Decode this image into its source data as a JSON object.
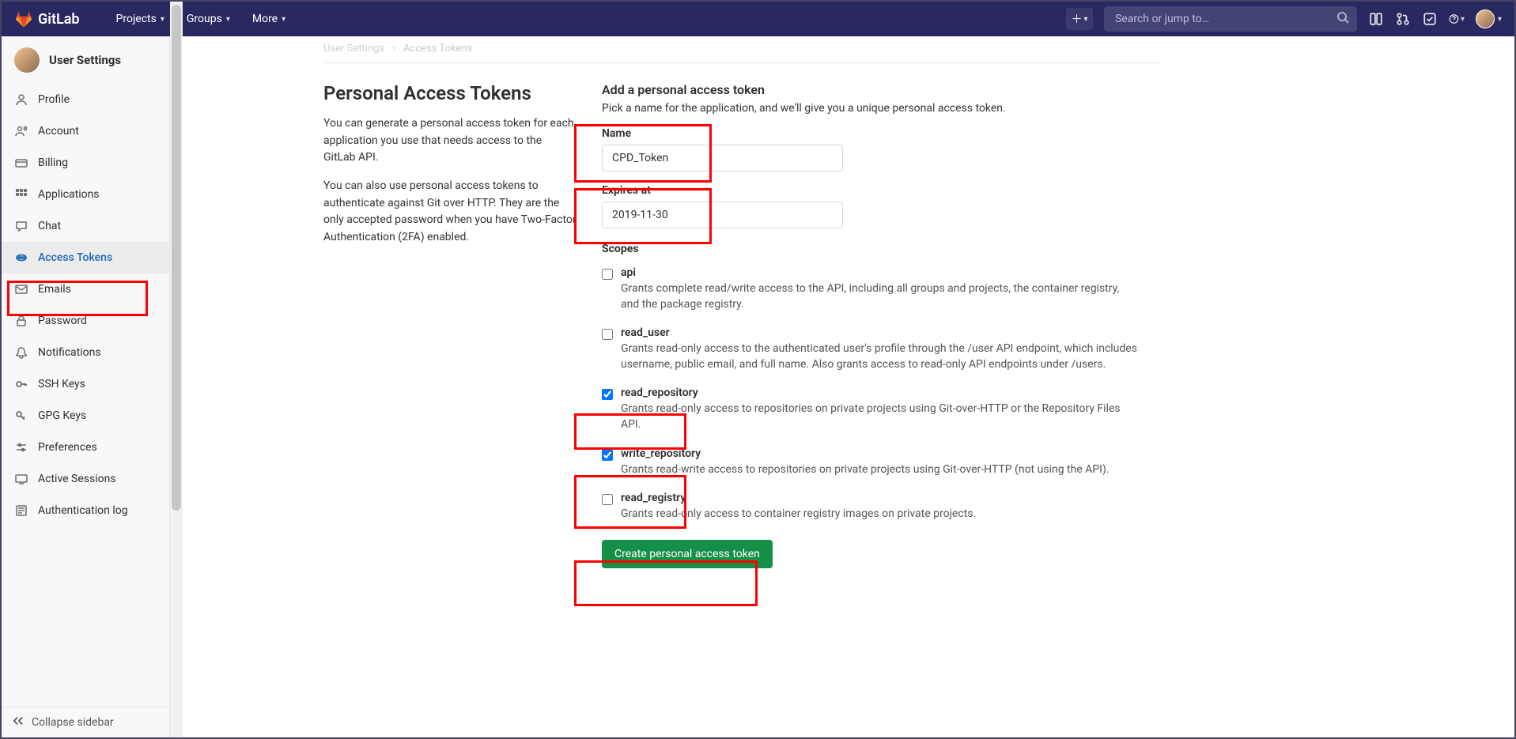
{
  "topbar": {
    "brand": "GitLab",
    "menu": [
      "Projects",
      "Groups",
      "More"
    ],
    "search_placeholder": "Search or jump to…"
  },
  "sidebar": {
    "title": "User Settings",
    "items": [
      {
        "icon": "profile",
        "label": "Profile"
      },
      {
        "icon": "account",
        "label": "Account"
      },
      {
        "icon": "billing",
        "label": "Billing"
      },
      {
        "icon": "apps",
        "label": "Applications"
      },
      {
        "icon": "chat",
        "label": "Chat"
      },
      {
        "icon": "tokens",
        "label": "Access Tokens"
      },
      {
        "icon": "emails",
        "label": "Emails"
      },
      {
        "icon": "password",
        "label": "Password"
      },
      {
        "icon": "notif",
        "label": "Notifications"
      },
      {
        "icon": "ssh",
        "label": "SSH Keys"
      },
      {
        "icon": "gpg",
        "label": "GPG Keys"
      },
      {
        "icon": "pref",
        "label": "Preferences"
      },
      {
        "icon": "sessions",
        "label": "Active Sessions"
      },
      {
        "icon": "auth",
        "label": "Authentication log"
      }
    ],
    "collapse": "Collapse sidebar"
  },
  "breadcrumb": {
    "a": "User Settings",
    "b": "Access Tokens"
  },
  "left": {
    "title": "Personal Access Tokens",
    "p1": "You can generate a personal access token for each application you use that needs access to the GitLab API.",
    "p2": "You can also use personal access tokens to authenticate against Git over HTTP. They are the only accepted password when you have Two-Factor Authentication (2FA) enabled."
  },
  "form": {
    "title": "Add a personal access token",
    "sub": "Pick a name for the application, and we'll give you a unique personal access token.",
    "name_label": "Name",
    "name_value": "CPD_Token",
    "expires_label": "Expires at",
    "expires_value": "2019-11-30",
    "scopes_label": "Scopes",
    "scopes": [
      {
        "key": "api",
        "label": "api",
        "checked": false,
        "desc": "Grants complete read/write access to the API, including all groups and projects, the container registry, and the package registry."
      },
      {
        "key": "read_user",
        "label": "read_user",
        "checked": false,
        "desc": "Grants read-only access to the authenticated user's profile through the /user API endpoint, which includes username, public email, and full name. Also grants access to read-only API endpoints under /users."
      },
      {
        "key": "read_repository",
        "label": "read_repository",
        "checked": true,
        "desc": "Grants read-only access to repositories on private projects using Git-over-HTTP or the Repository Files API."
      },
      {
        "key": "write_repository",
        "label": "write_repository",
        "checked": true,
        "desc": "Grants read-write access to repositories on private projects using Git-over-HTTP (not using the API)."
      },
      {
        "key": "read_registry",
        "label": "read_registry",
        "checked": false,
        "desc": "Grants read-only access to container registry images on private projects."
      }
    ],
    "submit": "Create personal access token"
  }
}
